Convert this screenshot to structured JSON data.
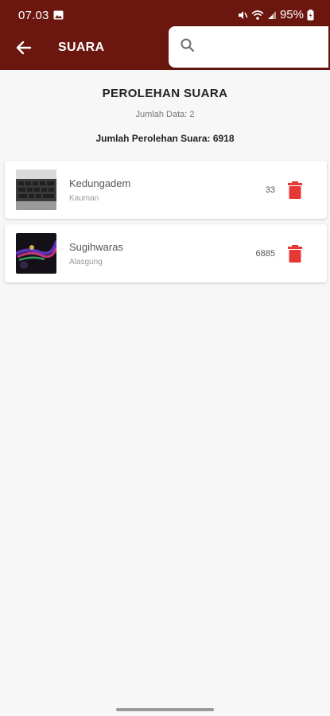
{
  "status_bar": {
    "time": "07.03",
    "battery": "95%"
  },
  "app_bar": {
    "title": "SUARA",
    "search_placeholder": ""
  },
  "summary": {
    "heading": "PEROLEHAN SUARA",
    "data_count": "Jumlah Data: 2",
    "total_votes": "Jumlah Perolehan Suara: 6918"
  },
  "items": [
    {
      "name": "Kedungadem",
      "location": "Kauman",
      "votes": "33",
      "thumb": "keyboard-photo"
    },
    {
      "name": "Sugihwaras",
      "location": "Alasgung",
      "votes": "6885",
      "thumb": "rgb-light-photo"
    }
  ],
  "colors": {
    "primary": "#6b1710",
    "delete": "#e53935"
  }
}
